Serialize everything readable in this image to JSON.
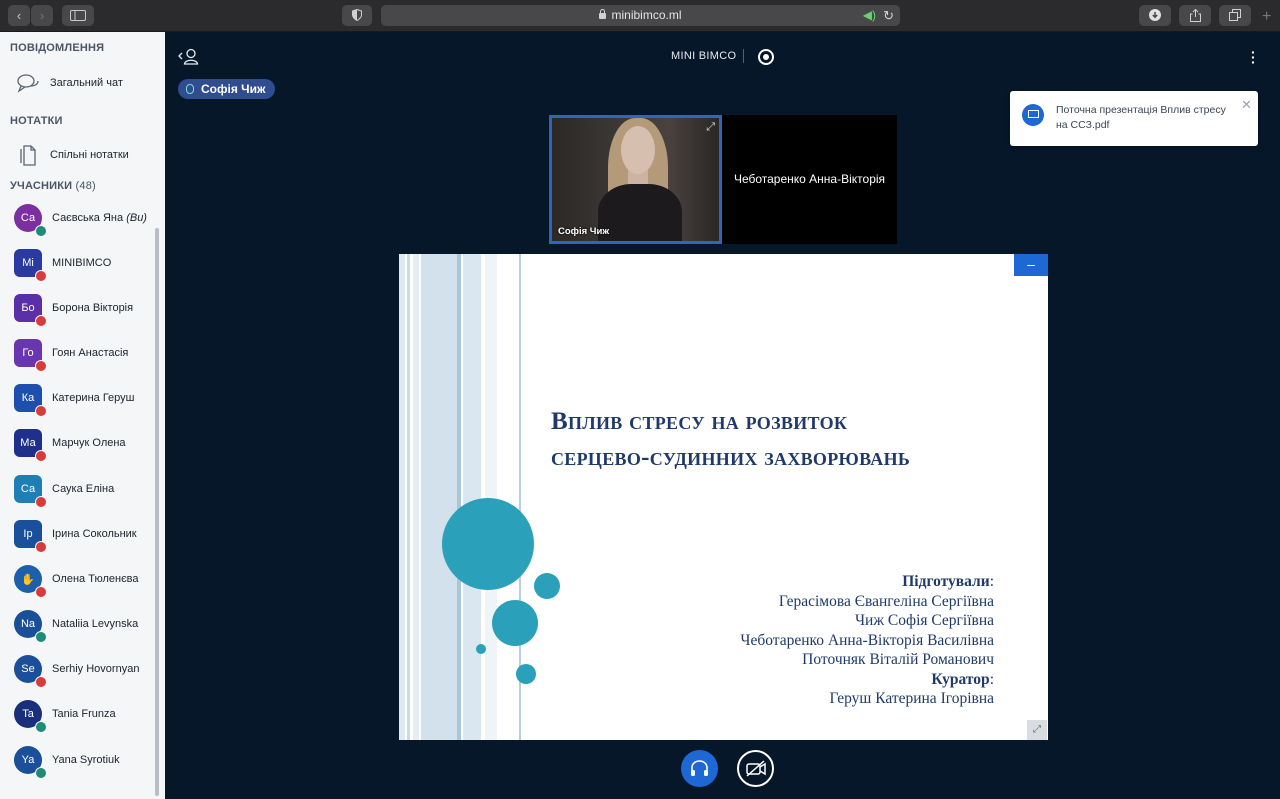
{
  "browser": {
    "url": "minibimco.ml"
  },
  "sidebar": {
    "messages_title": "ПОВІДОМЛЕННЯ",
    "public_chat": "Загальний чат",
    "notes_title": "НОТАТКИ",
    "shared_notes": "Спільні нотатки",
    "users_title": "УЧАСНИКИ",
    "users_count": "(48)",
    "users": [
      {
        "initials": "Са",
        "name": "Саєвська Яна",
        "suffix": "(Ви)",
        "color": "#7b2fa0",
        "status": "green",
        "round": true
      },
      {
        "initials": "Mi",
        "name": "MINIBIMCO",
        "suffix": "",
        "color": "#2b3aa0",
        "status": "red",
        "round": false
      },
      {
        "initials": "Бо",
        "name": "Борона Вікторія",
        "suffix": "",
        "color": "#5b2fa8",
        "status": "red",
        "round": false
      },
      {
        "initials": "Го",
        "name": "Гоян Анастасія",
        "suffix": "",
        "color": "#6a36b0",
        "status": "red",
        "round": false
      },
      {
        "initials": "Ка",
        "name": "Катерина Геруш",
        "suffix": "",
        "color": "#1f4fae",
        "status": "red",
        "round": false
      },
      {
        "initials": "Ма",
        "name": "Марчук Олена",
        "suffix": "",
        "color": "#1f2f8c",
        "status": "red",
        "round": false
      },
      {
        "initials": "Са",
        "name": "Саука Еліна",
        "suffix": "",
        "color": "#1e7fb6",
        "status": "red",
        "round": false
      },
      {
        "initials": "Ір",
        "name": "Ірина Сокольник",
        "suffix": "",
        "color": "#1a4f9c",
        "status": "red",
        "round": false
      },
      {
        "initials": "✋",
        "name": "Олена Тюленєва",
        "suffix": "",
        "color": "#1d5faa",
        "status": "red",
        "round": true
      },
      {
        "initials": "Na",
        "name": "Nataliia Levynska",
        "suffix": "",
        "color": "#1c4f9a",
        "status": "green",
        "round": true
      },
      {
        "initials": "Se",
        "name": "Serhiy Hovornyan",
        "suffix": "",
        "color": "#1c4f9a",
        "status": "red",
        "round": true
      },
      {
        "initials": "Ta",
        "name": "Tania Frunza",
        "suffix": "",
        "color": "#1a2f7c",
        "status": "green",
        "round": true
      },
      {
        "initials": "Ya",
        "name": "Yana Syrotiuk",
        "suffix": "",
        "color": "#1c4f9a",
        "status": "green",
        "round": true
      }
    ]
  },
  "main": {
    "title": "MINI BIMCO",
    "speaker": "Софія Чиж",
    "notification": "Поточна презентація Вплив стресу на ССЗ.pdf",
    "video_main_name": "Софія Чиж",
    "video_second_name": "Чеботаренко Анна-Вікторія"
  },
  "slide": {
    "title_line1": "Вплив стресу на розвиток",
    "title_line2": "серцево-судинних захворювань",
    "prepared_label": "Підготували",
    "authors": [
      "Герасімова Євангеліна Сергіївна",
      "Чиж Софія Сергіївна",
      "Чеботаренко Анна-Вікторія Василівна",
      "Поточняк Віталій Романович"
    ],
    "curator_label": "Куратор",
    "curator": "Геруш Катерина Ігорівна"
  },
  "colors": {
    "accent": "#1d68d4",
    "slide_text": "#1f3a6a",
    "slide_circle": "#2aa0ba",
    "background": "#06172a"
  },
  "icons": [
    "back-icon",
    "forward-icon",
    "sidebar-icon",
    "shield-icon",
    "lock-icon",
    "speaker-icon",
    "reload-icon",
    "download-icon",
    "share-icon",
    "tabs-icon",
    "new-tab-icon",
    "chat-icon",
    "notes-icon",
    "user-icon",
    "record-icon",
    "more-icon",
    "mic-icon",
    "presentation-icon",
    "close-icon",
    "expand-icon",
    "minimize-icon",
    "fullscreen-icon",
    "headphones-icon",
    "camera-off-icon"
  ]
}
